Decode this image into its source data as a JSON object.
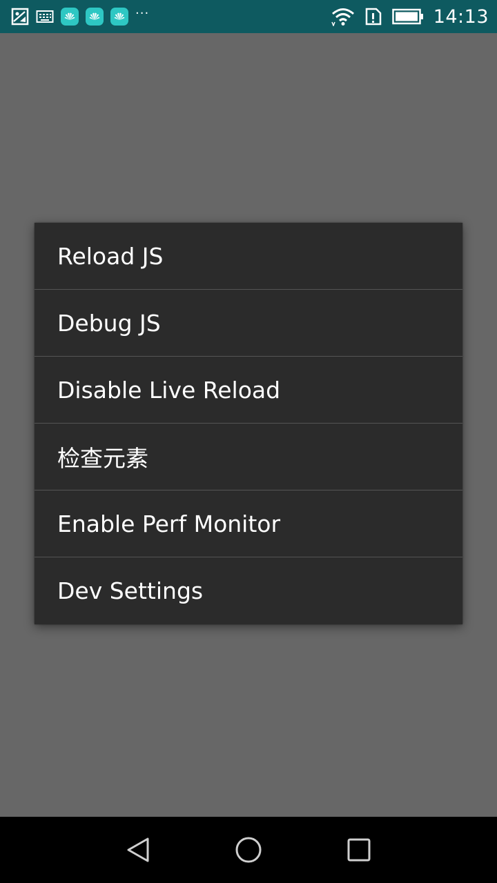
{
  "status_bar": {
    "time": "14:13",
    "notification_icons": [
      "gallery-icon",
      "keyboard-icon",
      "huawei-app-icon",
      "huawei-app-icon",
      "huawei-app-icon"
    ],
    "more_indicator": "···",
    "colors": {
      "background": "#0e5a60",
      "app_badge": "#2ec7c3"
    }
  },
  "dev_menu": {
    "items": [
      {
        "label": "Reload JS"
      },
      {
        "label": "Debug JS"
      },
      {
        "label": "Disable Live Reload"
      },
      {
        "label": "检查元素"
      },
      {
        "label": "Enable Perf Monitor"
      },
      {
        "label": "Dev Settings"
      }
    ],
    "colors": {
      "background": "#2b2b2b",
      "divider": "#555555",
      "text": "#ffffff",
      "scrim": "#676767"
    }
  },
  "nav_bar": {
    "buttons": [
      "back-icon",
      "home-icon",
      "recents-icon"
    ]
  }
}
